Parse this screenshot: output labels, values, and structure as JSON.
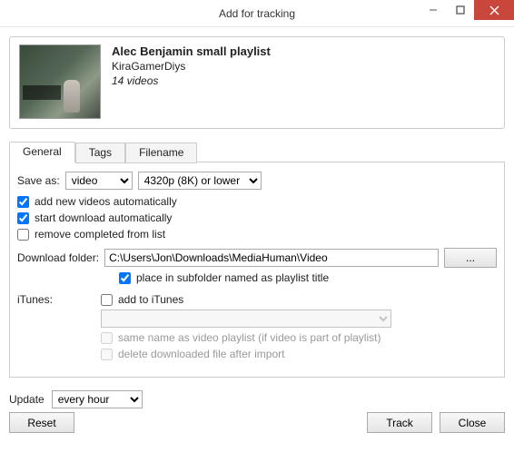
{
  "window": {
    "title": "Add for tracking"
  },
  "playlist": {
    "title": "Alec Benjamin small playlist",
    "author": "KiraGamerDiys",
    "count_label": "14 videos"
  },
  "tabs": {
    "general": "General",
    "tags": "Tags",
    "filename": "Filename"
  },
  "general": {
    "save_as_label": "Save as:",
    "save_as_type": "video",
    "save_as_quality": "4320p (8K) or lower",
    "chk_add_new": "add new videos automatically",
    "chk_start_dl": "start download automatically",
    "chk_remove": "remove completed from list",
    "download_folder_label": "Download folder:",
    "download_folder_value": "C:\\Users\\Jon\\Downloads\\MediaHuman\\Video",
    "browse_label": "...",
    "chk_subfolder": "place in subfolder named as playlist title",
    "itunes_label": "iTunes:",
    "chk_itunes": "add to iTunes",
    "chk_samename": "same name as video playlist (if video is part of playlist)",
    "chk_delete_after": "delete downloaded file after import"
  },
  "bottom": {
    "update_label": "Update",
    "update_value": "every hour",
    "reset": "Reset",
    "track": "Track",
    "close": "Close"
  }
}
